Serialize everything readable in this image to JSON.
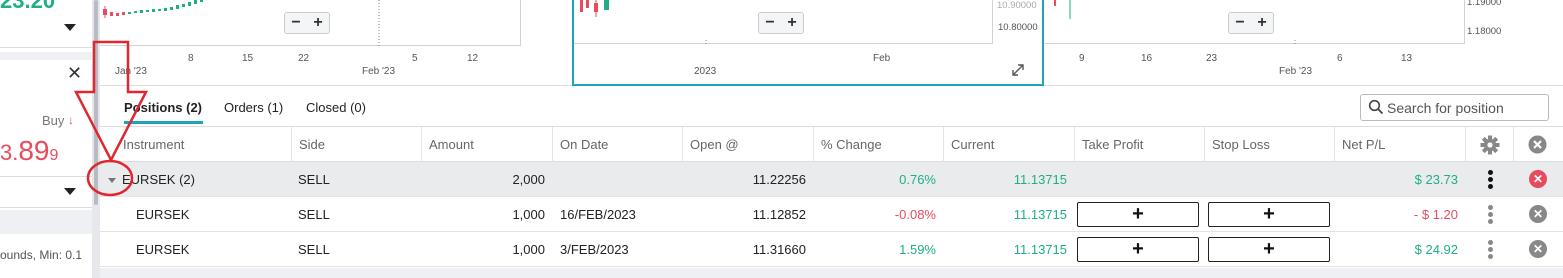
{
  "left_panel": {
    "big_value": "23.20",
    "buy_label": "Buy",
    "buy_arrow": "↓",
    "price_prefix": "3.",
    "price_main": "89",
    "price_suffix": "9",
    "close_glyph": "✕",
    "rounds_text": "ounds, Min: 0.1"
  },
  "charts": [
    {
      "x_ticks": [
        "Jan '23",
        "8",
        "15",
        "22",
        "Feb '23",
        "5",
        "12"
      ],
      "zoom_minus": "−",
      "zoom_plus": "+"
    },
    {
      "x_ticks": [
        "2023",
        "Feb"
      ],
      "y_ticks": [
        "10.80000"
      ],
      "zoom_minus": "−",
      "zoom_plus": "+",
      "expand_icon": "expand-icon"
    },
    {
      "x_ticks": [
        "9",
        "16",
        "23",
        "Feb '23",
        "6",
        "13"
      ],
      "y_ticks": [
        "1.19000",
        "1.18000"
      ],
      "zoom_minus": "−",
      "zoom_plus": "+"
    }
  ],
  "tabs": [
    {
      "label": "Positions (2)",
      "active": true
    },
    {
      "label": "Orders (1)",
      "active": false
    },
    {
      "label": "Closed (0)",
      "active": false
    }
  ],
  "search": {
    "placeholder": "Search for position"
  },
  "columns": [
    "Instrument",
    "Side",
    "Amount",
    "On Date",
    "Open @",
    "% Change",
    "Current",
    "Take Profit",
    "Stop Loss",
    "Net P/L"
  ],
  "header_icons": {
    "settings": "gear-icon",
    "close_all": "close-circle-icon"
  },
  "rows": [
    {
      "type": "group",
      "instrument": "EURSEK (2)",
      "side": "SELL",
      "amount": "2,000",
      "on_date": "",
      "open": "11.22256",
      "change": "0.76%",
      "change_color": "green",
      "current": "11.13715",
      "take_profit": "",
      "stop_loss": "",
      "net_pl": "$ 23.73",
      "net_color": "green"
    },
    {
      "type": "child",
      "instrument": "EURSEK",
      "side": "SELL",
      "amount": "1,000",
      "on_date": "16/FEB/2023",
      "open": "11.12852",
      "change": "-0.08%",
      "change_color": "red",
      "current": "11.13715",
      "take_profit": "+",
      "stop_loss": "+",
      "net_pl": "- $ 1.20",
      "net_color": "red"
    },
    {
      "type": "child",
      "instrument": "EURSEK",
      "side": "SELL",
      "amount": "1,000",
      "on_date": "3/FEB/2023",
      "open": "11.31660",
      "change": "1.59%",
      "change_color": "green",
      "current": "11.13715",
      "take_profit": "+",
      "stop_loss": "+",
      "net_pl": "$ 24.92",
      "net_color": "green"
    }
  ],
  "colors": {
    "accent": "#1ea3b8",
    "positive": "#1fae8a",
    "negative": "#e74c5e",
    "annotation": "#e0262e"
  }
}
